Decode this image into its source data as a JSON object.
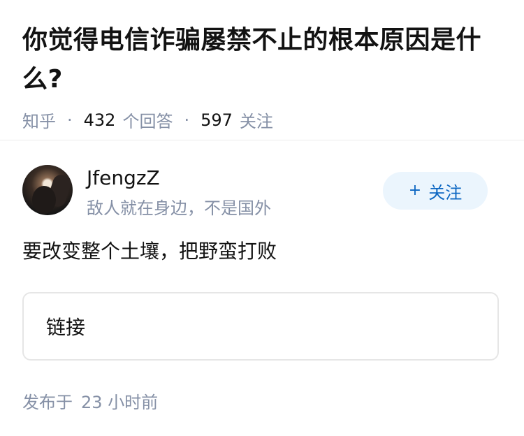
{
  "question": {
    "title": "你觉得电信诈骗屡禁不止的根本原因是什么?",
    "source": "知乎",
    "answer_count": "432",
    "answer_label": "个回答",
    "follower_count": "597",
    "follower_label": "关注",
    "separator": "·"
  },
  "author": {
    "name": "JfengzZ",
    "bio": "敌人就在身边，不是国外",
    "follow_label": "关注",
    "follow_icon": "+"
  },
  "answer": {
    "text": "要改变整个土壤，把野蛮打败",
    "link_label": "链接",
    "published_prefix": "发布于",
    "published_num": "23",
    "published_suffix": "小时前"
  },
  "colors": {
    "accent": "#0b66c2",
    "accent_bg": "#ebf5fd",
    "meta_gray": "#8590a6",
    "text": "#121212"
  }
}
